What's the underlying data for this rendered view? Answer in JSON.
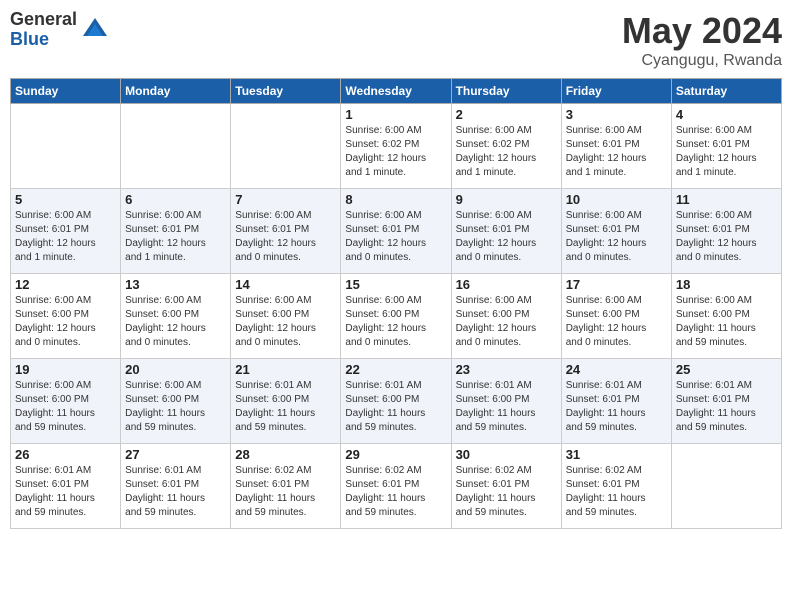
{
  "logo": {
    "general": "General",
    "blue": "Blue"
  },
  "header": {
    "month": "May 2024",
    "location": "Cyangugu, Rwanda"
  },
  "weekdays": [
    "Sunday",
    "Monday",
    "Tuesday",
    "Wednesday",
    "Thursday",
    "Friday",
    "Saturday"
  ],
  "weeks": [
    [
      {
        "day": "",
        "info": ""
      },
      {
        "day": "",
        "info": ""
      },
      {
        "day": "",
        "info": ""
      },
      {
        "day": "1",
        "info": "Sunrise: 6:00 AM\nSunset: 6:02 PM\nDaylight: 12 hours\nand 1 minute."
      },
      {
        "day": "2",
        "info": "Sunrise: 6:00 AM\nSunset: 6:02 PM\nDaylight: 12 hours\nand 1 minute."
      },
      {
        "day": "3",
        "info": "Sunrise: 6:00 AM\nSunset: 6:01 PM\nDaylight: 12 hours\nand 1 minute."
      },
      {
        "day": "4",
        "info": "Sunrise: 6:00 AM\nSunset: 6:01 PM\nDaylight: 12 hours\nand 1 minute."
      }
    ],
    [
      {
        "day": "5",
        "info": "Sunrise: 6:00 AM\nSunset: 6:01 PM\nDaylight: 12 hours\nand 1 minute."
      },
      {
        "day": "6",
        "info": "Sunrise: 6:00 AM\nSunset: 6:01 PM\nDaylight: 12 hours\nand 1 minute."
      },
      {
        "day": "7",
        "info": "Sunrise: 6:00 AM\nSunset: 6:01 PM\nDaylight: 12 hours\nand 0 minutes."
      },
      {
        "day": "8",
        "info": "Sunrise: 6:00 AM\nSunset: 6:01 PM\nDaylight: 12 hours\nand 0 minutes."
      },
      {
        "day": "9",
        "info": "Sunrise: 6:00 AM\nSunset: 6:01 PM\nDaylight: 12 hours\nand 0 minutes."
      },
      {
        "day": "10",
        "info": "Sunrise: 6:00 AM\nSunset: 6:01 PM\nDaylight: 12 hours\nand 0 minutes."
      },
      {
        "day": "11",
        "info": "Sunrise: 6:00 AM\nSunset: 6:01 PM\nDaylight: 12 hours\nand 0 minutes."
      }
    ],
    [
      {
        "day": "12",
        "info": "Sunrise: 6:00 AM\nSunset: 6:00 PM\nDaylight: 12 hours\nand 0 minutes."
      },
      {
        "day": "13",
        "info": "Sunrise: 6:00 AM\nSunset: 6:00 PM\nDaylight: 12 hours\nand 0 minutes."
      },
      {
        "day": "14",
        "info": "Sunrise: 6:00 AM\nSunset: 6:00 PM\nDaylight: 12 hours\nand 0 minutes."
      },
      {
        "day": "15",
        "info": "Sunrise: 6:00 AM\nSunset: 6:00 PM\nDaylight: 12 hours\nand 0 minutes."
      },
      {
        "day": "16",
        "info": "Sunrise: 6:00 AM\nSunset: 6:00 PM\nDaylight: 12 hours\nand 0 minutes."
      },
      {
        "day": "17",
        "info": "Sunrise: 6:00 AM\nSunset: 6:00 PM\nDaylight: 12 hours\nand 0 minutes."
      },
      {
        "day": "18",
        "info": "Sunrise: 6:00 AM\nSunset: 6:00 PM\nDaylight: 11 hours\nand 59 minutes."
      }
    ],
    [
      {
        "day": "19",
        "info": "Sunrise: 6:00 AM\nSunset: 6:00 PM\nDaylight: 11 hours\nand 59 minutes."
      },
      {
        "day": "20",
        "info": "Sunrise: 6:00 AM\nSunset: 6:00 PM\nDaylight: 11 hours\nand 59 minutes."
      },
      {
        "day": "21",
        "info": "Sunrise: 6:01 AM\nSunset: 6:00 PM\nDaylight: 11 hours\nand 59 minutes."
      },
      {
        "day": "22",
        "info": "Sunrise: 6:01 AM\nSunset: 6:00 PM\nDaylight: 11 hours\nand 59 minutes."
      },
      {
        "day": "23",
        "info": "Sunrise: 6:01 AM\nSunset: 6:00 PM\nDaylight: 11 hours\nand 59 minutes."
      },
      {
        "day": "24",
        "info": "Sunrise: 6:01 AM\nSunset: 6:01 PM\nDaylight: 11 hours\nand 59 minutes."
      },
      {
        "day": "25",
        "info": "Sunrise: 6:01 AM\nSunset: 6:01 PM\nDaylight: 11 hours\nand 59 minutes."
      }
    ],
    [
      {
        "day": "26",
        "info": "Sunrise: 6:01 AM\nSunset: 6:01 PM\nDaylight: 11 hours\nand 59 minutes."
      },
      {
        "day": "27",
        "info": "Sunrise: 6:01 AM\nSunset: 6:01 PM\nDaylight: 11 hours\nand 59 minutes."
      },
      {
        "day": "28",
        "info": "Sunrise: 6:02 AM\nSunset: 6:01 PM\nDaylight: 11 hours\nand 59 minutes."
      },
      {
        "day": "29",
        "info": "Sunrise: 6:02 AM\nSunset: 6:01 PM\nDaylight: 11 hours\nand 59 minutes."
      },
      {
        "day": "30",
        "info": "Sunrise: 6:02 AM\nSunset: 6:01 PM\nDaylight: 11 hours\nand 59 minutes."
      },
      {
        "day": "31",
        "info": "Sunrise: 6:02 AM\nSunset: 6:01 PM\nDaylight: 11 hours\nand 59 minutes."
      },
      {
        "day": "",
        "info": ""
      }
    ]
  ]
}
